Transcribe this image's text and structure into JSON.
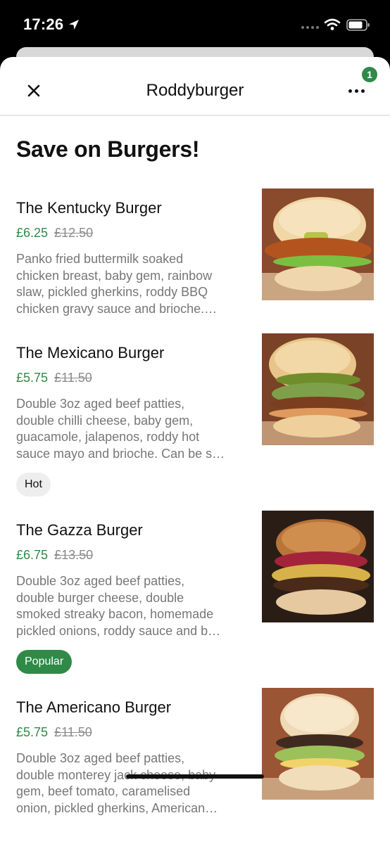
{
  "status_bar": {
    "time": "17:26",
    "icons": [
      "location-arrow-icon",
      "signal-dots-icon",
      "wifi-icon",
      "battery-icon"
    ]
  },
  "header": {
    "title": "Roddyburger",
    "close_icon": "close-icon",
    "more_icon": "more-horizontal-icon",
    "cart_badge": "1"
  },
  "section": {
    "title": "Save on Burgers!"
  },
  "items": [
    {
      "name": "The Kentucky Burger",
      "price": "£6.25",
      "original_price": "£12.50",
      "description_lines": [
        "Panko fried buttermilk soaked",
        "chicken breast, baby gem, rainbow",
        "slaw, pickled gherkins, roddy BBQ",
        "chicken gravy sauce and brioche.…"
      ],
      "tag": ""
    },
    {
      "name": "The Mexicano Burger",
      "price": "£5.75",
      "original_price": "£11.50",
      "description_lines": [
        "Double 3oz aged beef patties,",
        "double chilli cheese, baby gem,",
        "guacamole, jalapenos, roddy hot",
        "sauce mayo and brioche. Can be s…"
      ],
      "tag": "Hot"
    },
    {
      "name": "The Gazza Burger",
      "price": "£6.75",
      "original_price": "£13.50",
      "description_lines": [
        "Double 3oz aged beef patties,",
        "double burger cheese, double",
        "smoked streaky bacon, homemade",
        "pickled onions, roddy sauce and b…"
      ],
      "tag": "Popular"
    },
    {
      "name": "The Americano Burger",
      "price": "£5.75",
      "original_price": "£11.50",
      "description_lines": [
        "Double 3oz aged beef patties,",
        "double monterey jack cheese, baby",
        "gem, beef tomato, caramelised",
        "onion, pickled gherkins, American…"
      ],
      "tag": ""
    }
  ],
  "colors": {
    "accent_green": "#2f8a47",
    "price_strike": "#8a8a8a",
    "description": "#777777"
  }
}
